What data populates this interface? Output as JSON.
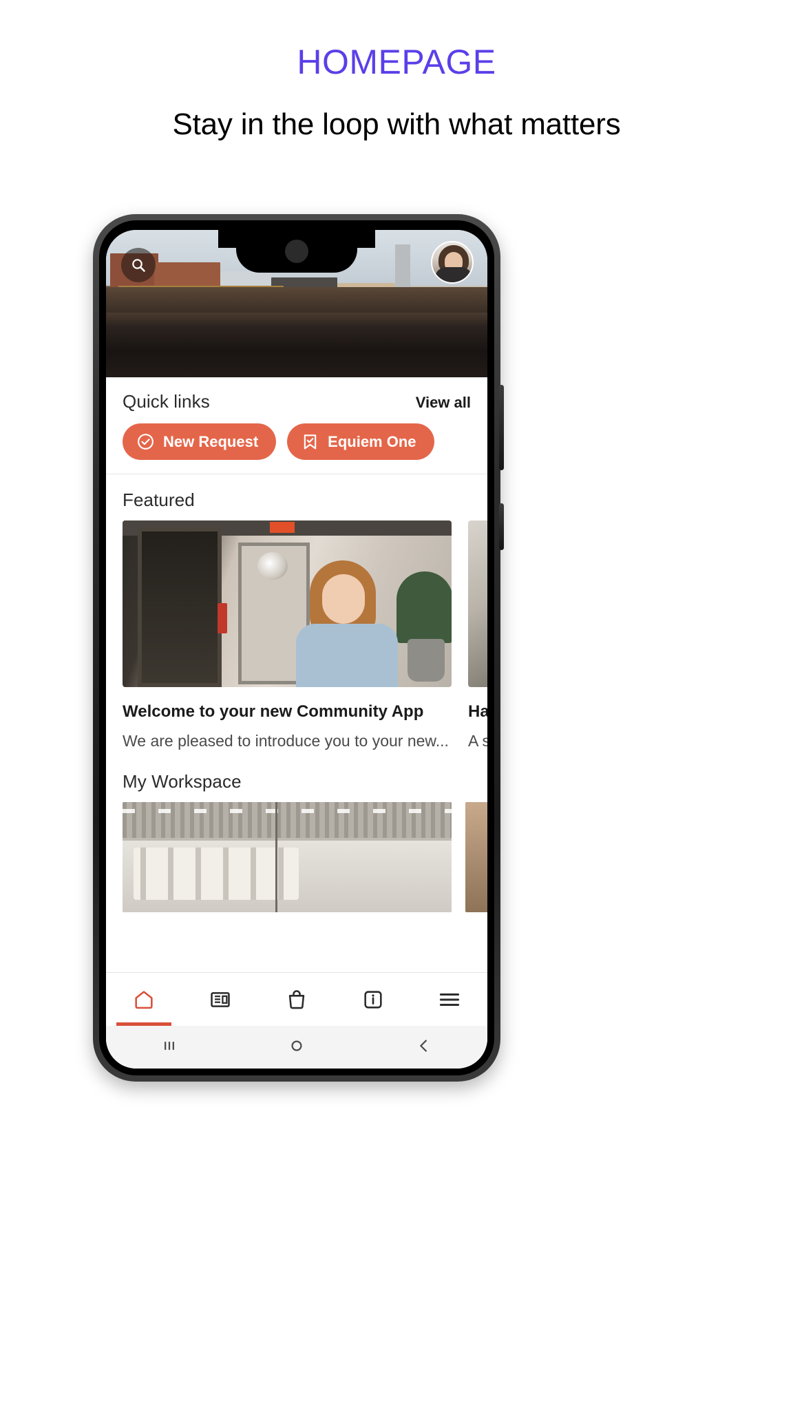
{
  "header": {
    "kicker": "HOMEPAGE",
    "kicker_color": "#5B3FE8",
    "subtitle": "Stay in the loop with what matters"
  },
  "phone": {
    "hero": {
      "search_icon": "search-icon",
      "avatar_label": "user-avatar"
    },
    "quick_links": {
      "title": "Quick links",
      "view_all": "View all",
      "pills": [
        {
          "label": "New Request",
          "icon": "check-circle-icon"
        },
        {
          "label": "Equiem One",
          "icon": "bookmark-check-icon"
        }
      ],
      "accent_color": "#E4664A"
    },
    "featured": {
      "title": "Featured",
      "cards": [
        {
          "title": "Welcome to your new Community App",
          "desc": "We are pleased to introduce you to your new..."
        },
        {
          "title": "Hav",
          "desc": "A se"
        }
      ]
    },
    "workspace": {
      "title": "My Workspace"
    },
    "bottom_nav": [
      {
        "name": "home",
        "icon": "home-icon",
        "active": true
      },
      {
        "name": "news",
        "icon": "news-icon",
        "active": false
      },
      {
        "name": "shop",
        "icon": "bag-icon",
        "active": false
      },
      {
        "name": "info",
        "icon": "info-icon",
        "active": false
      },
      {
        "name": "menu",
        "icon": "hamburger-icon",
        "active": false
      }
    ],
    "system_nav": [
      {
        "name": "recents",
        "icon": "recents-icon"
      },
      {
        "name": "home",
        "icon": "circle-icon"
      },
      {
        "name": "back",
        "icon": "back-chevron-icon"
      }
    ],
    "active_color": "#D9503A"
  }
}
